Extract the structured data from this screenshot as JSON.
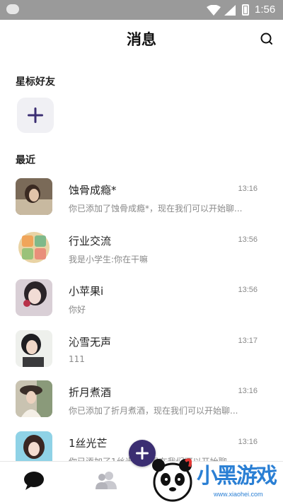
{
  "status_bar": {
    "time": "1:56"
  },
  "header": {
    "title": "消息"
  },
  "sections": {
    "starred": "星标好友",
    "recent": "最近"
  },
  "conversations": [
    {
      "name": "蚀骨成瘾*",
      "message": "你已添加了蚀骨成瘾*，现在我们可以开始聊...",
      "time": "13:16"
    },
    {
      "name": "行业交流",
      "message": "我是小学生:你在干嘛",
      "time": "13:56"
    },
    {
      "name": "小苹果i",
      "message": "你好",
      "time": "13:56"
    },
    {
      "name": "沁雪无声",
      "message": "111",
      "time": "13:17"
    },
    {
      "name": "折月煮酒",
      "message": "你已添加了折月煮酒，现在我们可以开始聊...",
      "time": "13:16"
    },
    {
      "name": "1丝光芒",
      "message": "你已添加了1丝光芒，现在我们可以开始聊...",
      "time": "13:16"
    }
  ],
  "watermark": {
    "text": "小黑游戏",
    "url": "www.xiaohei.com"
  },
  "colors": {
    "accent": "#3b2e72",
    "status_bar": "#9a9a9a",
    "watermark": "#2a7fd4"
  },
  "icons": [
    "search-icon",
    "plus-icon",
    "chat-icon",
    "contacts-icon",
    "wifi-icon",
    "signal-icon",
    "battery-icon"
  ]
}
